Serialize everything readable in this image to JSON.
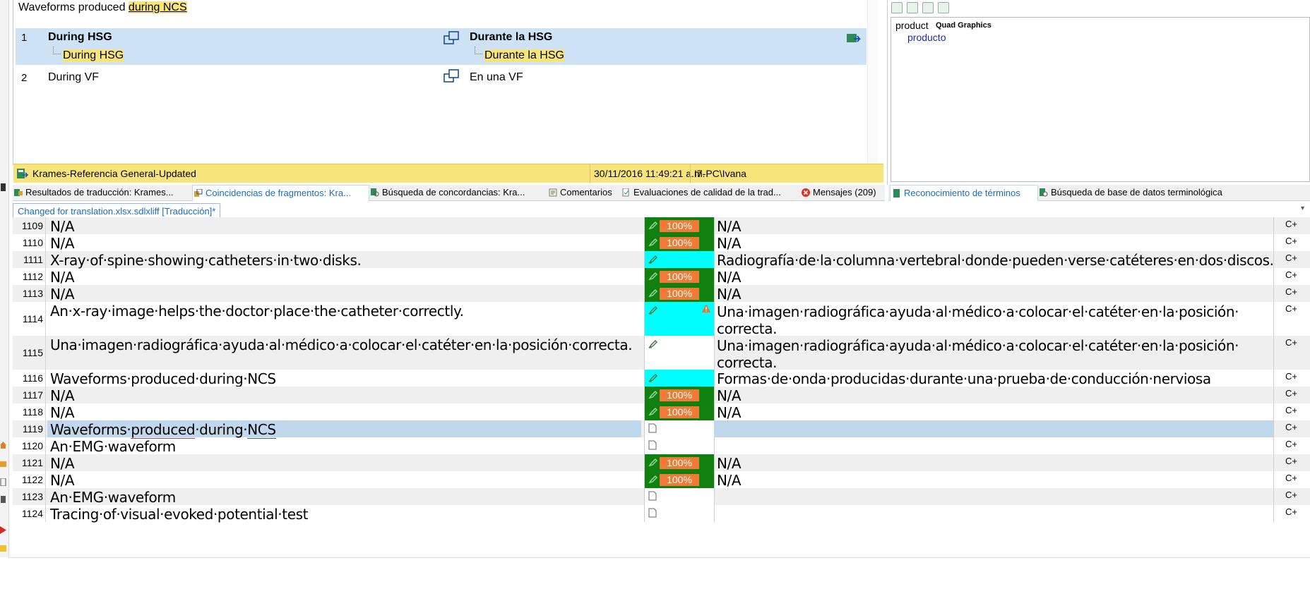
{
  "fragment_panel": {
    "source_prefix": "Waveforms produced ",
    "source_highlight": "during NCS",
    "matches": [
      {
        "num": "1",
        "source": "During HSG",
        "source_sub": "During HSG",
        "target": "Durante la HSG",
        "target_sub": "Durante la HSG"
      },
      {
        "num": "2",
        "source": "During VF",
        "target": "En una VF"
      }
    ],
    "tm_name": "Krames-Referencia General-Updated",
    "tm_date": "30/11/2016 11:49:21 a.m.",
    "tm_user": "I7-PC\\Ivana"
  },
  "tabs": [
    {
      "label": "Resultados de traducción: Krames...",
      "icon": "translation-results-icon"
    },
    {
      "label": "Coincidencias de fragmentos: Kra...",
      "icon": "fragment-matches-icon",
      "active": true
    },
    {
      "label": "Búsqueda de concordancias: Kra...",
      "icon": "concordance-icon"
    },
    {
      "label": "Comentarios",
      "icon": "comments-icon"
    },
    {
      "label": "Evaluaciones de calidad de la trad...",
      "icon": "quality-icon"
    },
    {
      "label": "Mensajes (209)",
      "icon": "error-icon"
    }
  ],
  "term_panel": {
    "source_term": "product",
    "termbase": "Quad Graphics",
    "target_term": "producto",
    "tabs": [
      {
        "label": "Reconocimiento de términos",
        "icon": "term-recognition-icon",
        "active": true
      },
      {
        "label": "Búsqueda de base de datos terminológica",
        "icon": "termbase-search-icon"
      }
    ]
  },
  "document_tab": "Changed for translation.xlsx.sdlxliff [Traducción]*",
  "segments": [
    {
      "num": "1109",
      "source": "N/A",
      "target": "N/A",
      "status": "green",
      "pct": "100%",
      "lock": "C+"
    },
    {
      "num": "1110",
      "source": "N/A",
      "target": "N/A",
      "status": "green",
      "pct": "100%",
      "lock": "C+"
    },
    {
      "num": "1111",
      "source": "X-ray·of·spine·showing·catheters·in·two·disks.",
      "target": "Radiografía·de·la·columna·vertebral·donde·pueden·verse·catéteres·en·dos·discos.",
      "status": "cyan",
      "pct": "",
      "lock": "C+"
    },
    {
      "num": "1112",
      "source": "N/A",
      "target": "N/A",
      "status": "green",
      "pct": "100%",
      "lock": "C+"
    },
    {
      "num": "1113",
      "source": "N/A",
      "target": "N/A",
      "status": "green",
      "pct": "100%",
      "lock": "C+"
    },
    {
      "num": "1114",
      "source": "An·x-ray·image·helps·the·doctor·place·the·catheter·correctly.",
      "target": "Una·imagen·radiográfica·ayuda·al·médico·a·colocar·el·catéter·en·la·posición·",
      "target2": "correcta.",
      "status": "cyan-warn",
      "pct": "",
      "lock": "C+"
    },
    {
      "num": "1115",
      "source": "Una·imagen·radiográfica·ayuda·al·médico·a·colocar·el·catéter·en·la·posición·correcta.",
      "target": "Una·imagen·radiográfica·ayuda·al·médico·a·colocar·el·catéter·en·la·posición·",
      "target2": "correcta.",
      "status": "pencil",
      "pct": "",
      "lock": "C+"
    },
    {
      "num": "1116",
      "source": "Waveforms·produced·during·NCS",
      "target": "Formas·de·onda·producidas·durante·una·prueba·de·conducción·nerviosa",
      "status": "cyan",
      "pct": "",
      "lock": "C+"
    },
    {
      "num": "1117",
      "source": "N/A",
      "target": "N/A",
      "status": "green",
      "pct": "100%",
      "lock": "C+"
    },
    {
      "num": "1118",
      "source": "N/A",
      "target": "N/A",
      "status": "green",
      "pct": "100%",
      "lock": "C+"
    },
    {
      "num": "1119",
      "source_a": "Waveforms·",
      "source_b": "produced",
      "source_c": "·during·",
      "source_d": "NCS",
      "target": "",
      "status": "doc",
      "pct": "",
      "lock": "C+"
    },
    {
      "num": "1120",
      "source": "An·EMG·waveform",
      "target": "",
      "status": "doc",
      "pct": "",
      "lock": "C+"
    },
    {
      "num": "1121",
      "source": "N/A",
      "target": "N/A",
      "status": "green",
      "pct": "100%",
      "lock": "C+"
    },
    {
      "num": "1122",
      "source": "N/A",
      "target": "N/A",
      "status": "green",
      "pct": "100%",
      "lock": "C+"
    },
    {
      "num": "1123",
      "source": "An·EMG·waveform",
      "target": "",
      "status": "doc",
      "pct": "",
      "lock": "C+"
    },
    {
      "num": "1124",
      "source": "Tracing·of·visual·evoked·potential·test",
      "target": "",
      "status": "doc",
      "pct": "",
      "lock": "C+"
    }
  ]
}
